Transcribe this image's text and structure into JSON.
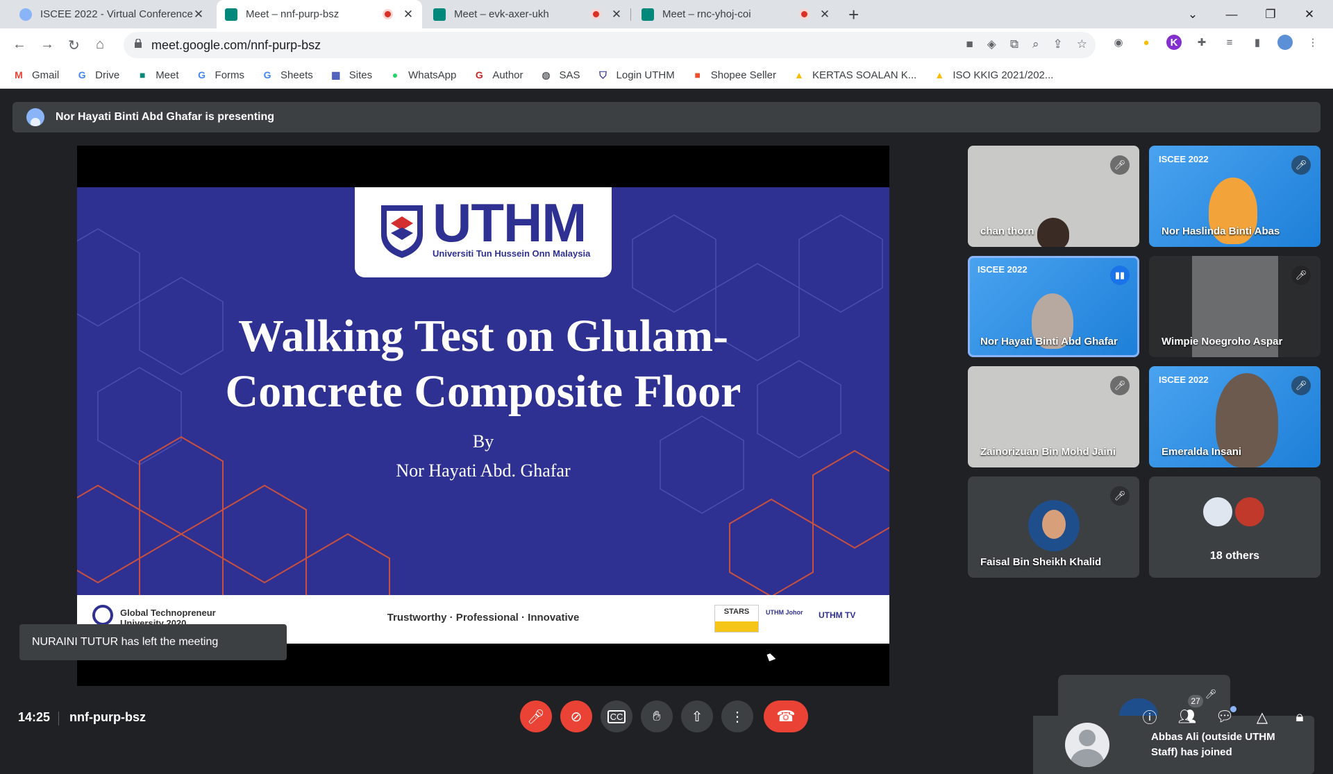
{
  "browser": {
    "tabs": [
      {
        "title": "ISCEE 2022 - Virtual Conference",
        "active": false,
        "recording": false
      },
      {
        "title": "Meet – nnf-purp-bsz",
        "active": true,
        "recording": true
      },
      {
        "title": "Meet – evk-axer-ukh",
        "active": false,
        "recording": true
      },
      {
        "title": "Meet – rnc-yhoj-coi",
        "active": false,
        "recording": true
      }
    ],
    "url": "meet.google.com/nnf-purp-bsz",
    "bookmarks": [
      {
        "label": "Gmail",
        "icon": "gmail-icon",
        "color": "#ea4335"
      },
      {
        "label": "Drive",
        "icon": "google-icon",
        "color": "#4285f4"
      },
      {
        "label": "Meet",
        "icon": "meet-icon",
        "color": "#00897b"
      },
      {
        "label": "Forms",
        "icon": "google-icon",
        "color": "#4285f4"
      },
      {
        "label": "Sheets",
        "icon": "google-icon",
        "color": "#4285f4"
      },
      {
        "label": "Sites",
        "icon": "sites-icon",
        "color": "#3f51b5"
      },
      {
        "label": "WhatsApp",
        "icon": "whatsapp-icon",
        "color": "#25d366"
      },
      {
        "label": "Author",
        "icon": "author-icon",
        "color": "#c62828"
      },
      {
        "label": "SAS",
        "icon": "sas-icon",
        "color": "#5f6368"
      },
      {
        "label": "Login UTHM",
        "icon": "uthm-icon",
        "color": "#2e3191"
      },
      {
        "label": "Shopee Seller",
        "icon": "shopee-icon",
        "color": "#ee4d2d"
      },
      {
        "label": "KERTAS SOALAN K...",
        "icon": "drive-icon",
        "color": "#fbbc04"
      },
      {
        "label": "ISO KKIG 2021/202...",
        "icon": "drive-icon",
        "color": "#fbbc04"
      }
    ]
  },
  "meeting": {
    "presenting_banner": "Nor Hayati Binti Abd Ghafar is presenting",
    "time": "14:25",
    "code": "nnf-purp-bsz",
    "participant_count": "27",
    "toast": "NURAINI TUTUR has left the meeting",
    "join_notice": "Abbas Ali (outside UTHM Staff) has joined"
  },
  "slide": {
    "logo_text": "UTHM",
    "logo_subtitle": "Universiti Tun Hussein Onn Malaysia",
    "title_line1": "Walking Test on Glulam-",
    "title_line2": "Concrete Composite Floor",
    "by": "By",
    "author": "Nor Hayati Abd. Ghafar",
    "footer_left_line1": "Global Technopreneur",
    "footer_left_line2": "University 2020",
    "tagline": "Trustworthy · Professional · Innovative",
    "stars_label": "STARS",
    "social_label": "UTHM Johor",
    "tv_label": "UTHM TV"
  },
  "participants": [
    {
      "name": "chan thorn",
      "muted": true,
      "style": "bright"
    },
    {
      "name": "Nor Haslinda Binti Abas",
      "muted": true,
      "style": "blue"
    },
    {
      "name": "Nor Hayati Binti Abd Ghafar",
      "muted": false,
      "style": "blue",
      "speaking": true
    },
    {
      "name": "Wimpie Noegroho Aspar",
      "muted": true,
      "style": "dark"
    },
    {
      "name": "Zainorizuan Bin Mohd Jaini",
      "muted": true,
      "style": "bright"
    },
    {
      "name": "Emeralda Insani",
      "muted": true,
      "style": "blue"
    },
    {
      "name": "Faisal Bin Sheikh Khalid",
      "muted": true,
      "style": "avatar"
    },
    {
      "name": "18 others",
      "muted": false,
      "style": "group"
    }
  ],
  "iscee_tag": "ISCEE 2022",
  "colors": {
    "accent": "#8ab4f8",
    "danger": "#ea4335",
    "slide_bg": "#2e3191"
  }
}
